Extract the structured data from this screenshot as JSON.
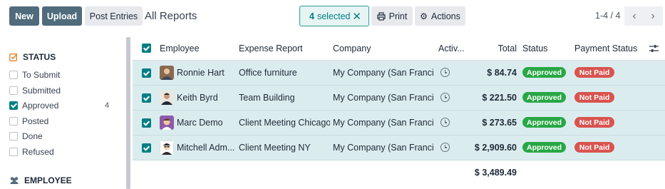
{
  "control_panel": {
    "new_label": "New",
    "upload_label": "Upload",
    "post_entries_label": "Post Entries",
    "breadcrumb": "All Reports",
    "selected_count": "4",
    "selected_text": "selected",
    "print_label": "Print",
    "actions_label": "Actions",
    "pager_value": "1-4 / 4"
  },
  "sidebar": {
    "status_heading": "STATUS",
    "status_items": [
      {
        "label": "To Submit",
        "checked": false,
        "count": ""
      },
      {
        "label": "Submitted",
        "checked": false,
        "count": ""
      },
      {
        "label": "Approved",
        "checked": true,
        "count": "4"
      },
      {
        "label": "Posted",
        "checked": false,
        "count": ""
      },
      {
        "label": "Done",
        "checked": false,
        "count": ""
      },
      {
        "label": "Refused",
        "checked": false,
        "count": ""
      }
    ],
    "employee_heading": "EMPLOYEE"
  },
  "table": {
    "columns": {
      "employee": "Employee",
      "expense_report": "Expense Report",
      "company": "Company",
      "activities": "Activ...",
      "total": "Total",
      "status": "Status",
      "payment_status": "Payment Status"
    },
    "rows": [
      {
        "employee": "Ronnie Hart",
        "report": "Office furniture",
        "company": "My Company (San Franci...",
        "total": "$ 84.74",
        "status": "Approved",
        "payment": "Not Paid"
      },
      {
        "employee": "Keith Byrd",
        "report": "Team Building",
        "company": "My Company (San Franci...",
        "total": "$ 221.50",
        "status": "Approved",
        "payment": "Not Paid"
      },
      {
        "employee": "Marc Demo",
        "report": "Client Meeting Chicago",
        "company": "My Company (San Franci...",
        "total": "$ 273.65",
        "status": "Approved",
        "payment": "Not Paid"
      },
      {
        "employee": "Mitchell Adm...",
        "report": "Client Meeting NY",
        "company": "My Company (San Franci...",
        "total": "$ 2,909.60",
        "status": "Approved",
        "payment": "Not Paid"
      }
    ],
    "grand_total": "$ 3,489.49"
  },
  "colors": {
    "primary": "#4f6b7c",
    "accent": "#017e84",
    "selected_row": "#dbecef",
    "approved": "#28a745",
    "not_paid": "#d9534f"
  }
}
